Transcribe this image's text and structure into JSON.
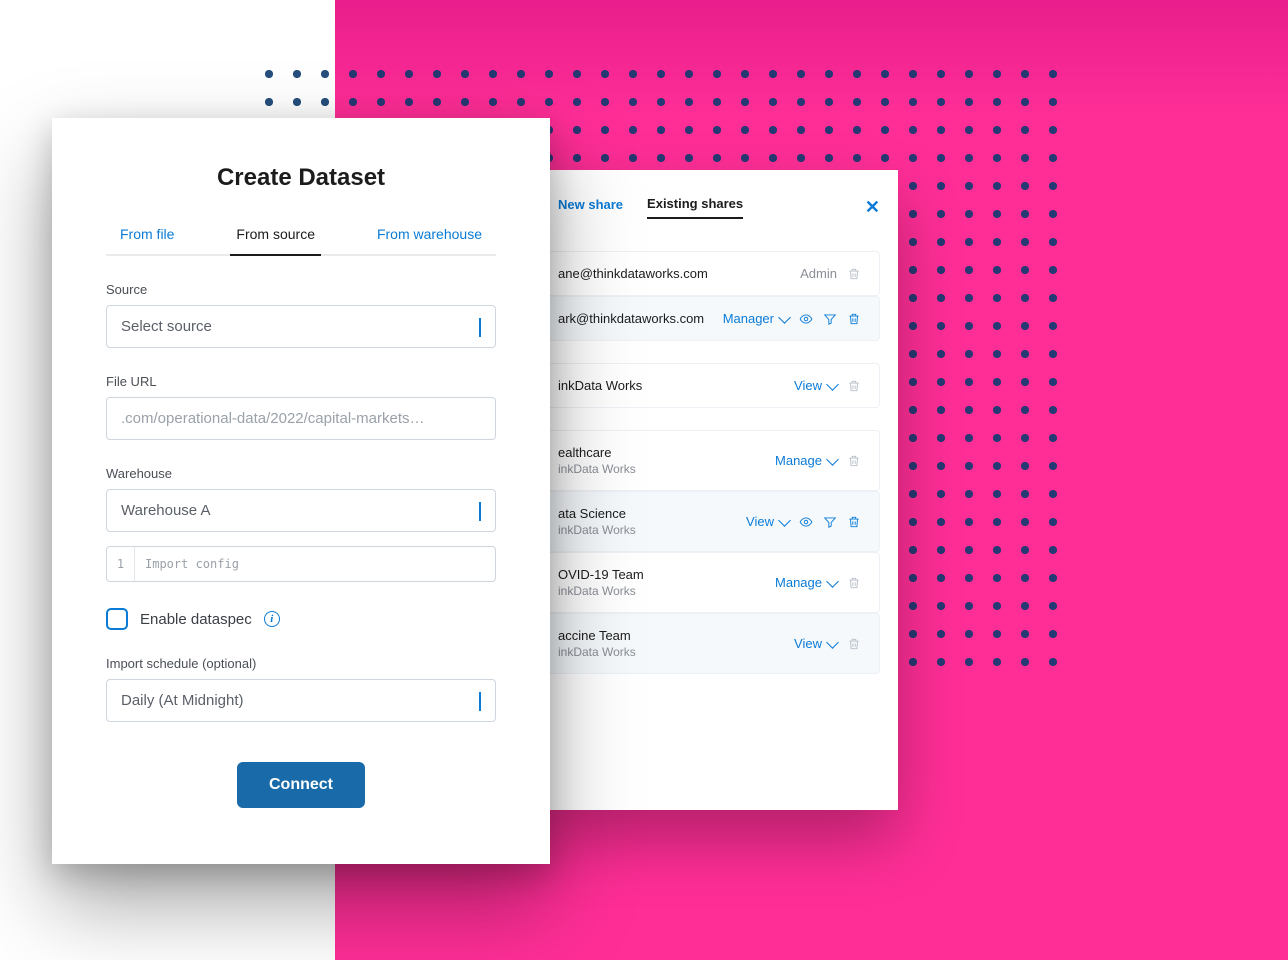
{
  "shares": {
    "tabs": [
      "New share",
      "Existing shares"
    ],
    "active_tab": 1,
    "rows": [
      {
        "email": "ane@thinkdataworks.com",
        "sub": "",
        "role": "Admin",
        "role_link": false,
        "eye": false,
        "filter": false,
        "trash": true
      },
      {
        "email": "ark@thinkdataworks.com",
        "sub": "",
        "role": "Manager",
        "role_link": true,
        "eye": true,
        "filter": true,
        "trash": true
      },
      {
        "email": "inkData Works",
        "sub": "",
        "role": "View",
        "role_link": true,
        "eye": false,
        "filter": false,
        "trash": true
      },
      {
        "email": "ealthcare",
        "sub": "inkData Works",
        "role": "Manage",
        "role_link": true,
        "eye": false,
        "filter": false,
        "trash": true
      },
      {
        "email": "ata Science",
        "sub": "inkData Works",
        "role": "View",
        "role_link": true,
        "eye": true,
        "filter": true,
        "trash": true
      },
      {
        "email": "OVID-19 Team",
        "sub": "inkData Works",
        "role": "Manage",
        "role_link": true,
        "eye": false,
        "filter": false,
        "trash": true
      },
      {
        "email": "accine Team",
        "sub": "inkData Works",
        "role": "View",
        "role_link": true,
        "eye": false,
        "filter": false,
        "trash": true
      }
    ]
  },
  "create": {
    "title": "Create Dataset",
    "tabs": [
      "From file",
      "From source",
      "From warehouse"
    ],
    "active_tab": 1,
    "source_label": "Source",
    "source_value": "Select source",
    "fileurl_label": "File URL",
    "fileurl_placeholder": ".com/operational-data/2022/capital-markets…",
    "warehouse_label": "Warehouse",
    "warehouse_value": "Warehouse A",
    "code_line": "1",
    "code_placeholder": "Import config",
    "check_label": "Enable dataspec",
    "schedule_label": "Import schedule (optional)",
    "schedule_value": "Daily (At Midnight)",
    "connect_label": "Connect"
  }
}
